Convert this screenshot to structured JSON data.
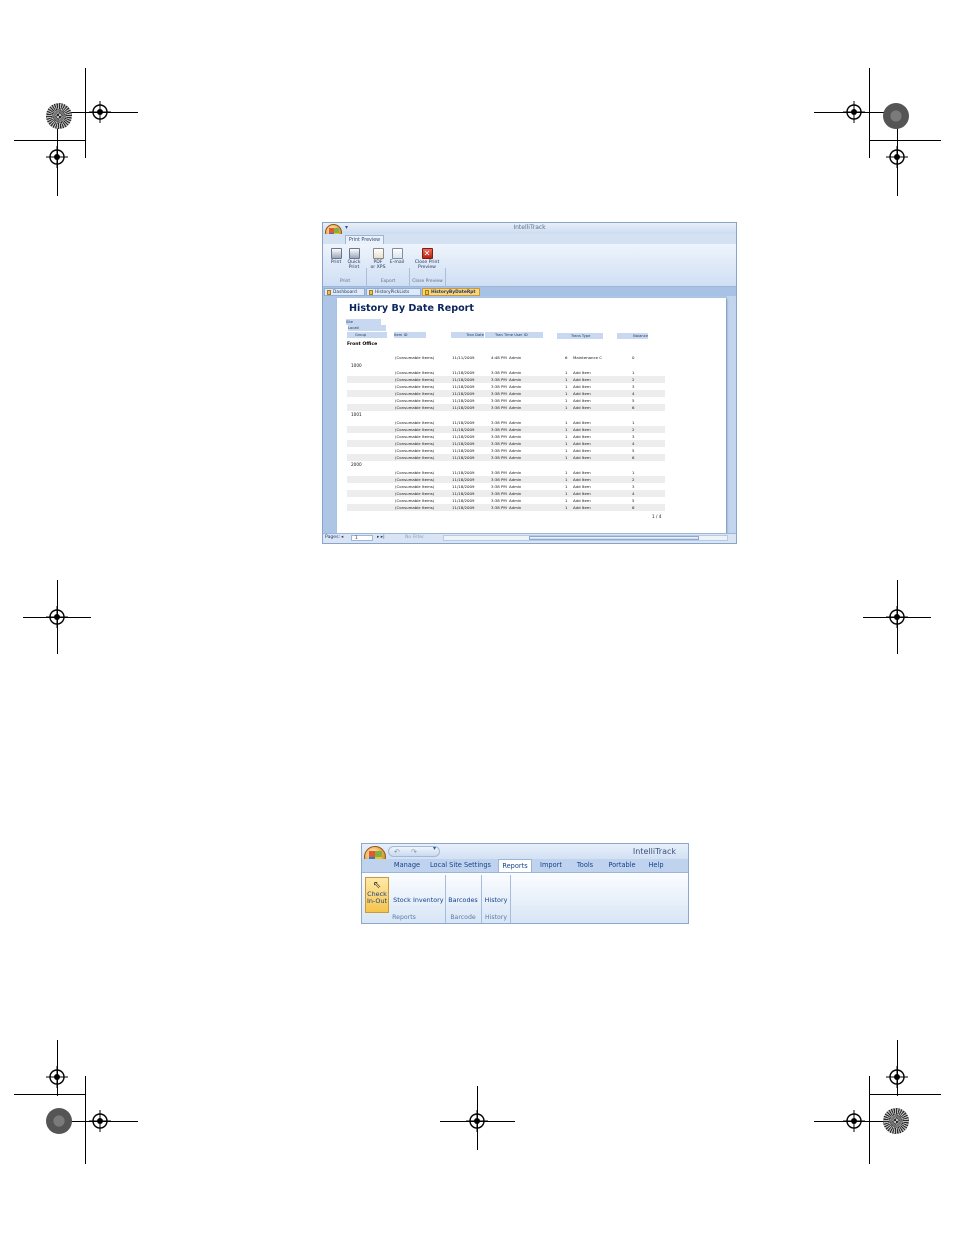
{
  "preview_window": {
    "app_title": "IntelliTrack",
    "qat_arrow": "▾",
    "ribbon_tab": "Print Preview",
    "buttons": {
      "print": "Print",
      "quick_print_1": "Quick",
      "quick_print_2": "Print",
      "pdf_1": "PDF",
      "pdf_2": "or XPS",
      "email": "E-mail",
      "close_1": "Close Print",
      "close_2": "Preview"
    },
    "groups": {
      "print": "Print",
      "export": "Export",
      "close": "Close Preview"
    },
    "document_tabs": [
      "Dashboard",
      "HistoryPickLists",
      "HistoryByDateRpt"
    ],
    "status": {
      "pages_label": "Pages:",
      "page_value": "1",
      "filter": "No Filter"
    },
    "report": {
      "title": "History By Date Report",
      "header_site": "Site",
      "header_location": "Locati",
      "header_group": "Group",
      "columns": [
        "Item ID",
        "Tran Date",
        "Tran Time  User ID",
        "Trans Type",
        "Balance"
      ],
      "site_name": "Front Office",
      "first_row": {
        "item": "(Consumable Items)",
        "date": "11/11/2009",
        "time": "4:48 PM",
        "user": "Admin",
        "qty": "6",
        "type": "Maintenance C",
        "bal": "0"
      },
      "groups": [
        {
          "name": "1000",
          "rows": [
            {
              "item": "(Consumable Items)",
              "date": "11/18/2009",
              "time": "3:38 PM",
              "user": "Admin",
              "qty": "1",
              "type": "Add Item",
              "bal": "1"
            },
            {
              "item": "(Consumable Items)",
              "date": "11/18/2009",
              "time": "3:38 PM",
              "user": "Admin",
              "qty": "1",
              "type": "Add Item",
              "bal": "2"
            },
            {
              "item": "(Consumable Items)",
              "date": "11/18/2009",
              "time": "3:38 PM",
              "user": "Admin",
              "qty": "1",
              "type": "Add Item",
              "bal": "3"
            },
            {
              "item": "(Consumable Items)",
              "date": "11/18/2009",
              "time": "3:38 PM",
              "user": "Admin",
              "qty": "1",
              "type": "Add Item",
              "bal": "4"
            },
            {
              "item": "(Consumable Items)",
              "date": "11/18/2009",
              "time": "3:38 PM",
              "user": "Admin",
              "qty": "1",
              "type": "Add Item",
              "bal": "5"
            },
            {
              "item": "(Consumable Items)",
              "date": "11/18/2009",
              "time": "3:38 PM",
              "user": "Admin",
              "qty": "1",
              "type": "Add Item",
              "bal": "6"
            }
          ]
        },
        {
          "name": "1001",
          "rows": [
            {
              "item": "(Consumable Items)",
              "date": "11/18/2009",
              "time": "3:38 PM",
              "user": "Admin",
              "qty": "1",
              "type": "Add Item",
              "bal": "1"
            },
            {
              "item": "(Consumable Items)",
              "date": "11/18/2009",
              "time": "3:38 PM",
              "user": "Admin",
              "qty": "1",
              "type": "Add Item",
              "bal": "2"
            },
            {
              "item": "(Consumable Items)",
              "date": "11/18/2009",
              "time": "3:38 PM",
              "user": "Admin",
              "qty": "1",
              "type": "Add Item",
              "bal": "3"
            },
            {
              "item": "(Consumable Items)",
              "date": "11/18/2009",
              "time": "3:38 PM",
              "user": "Admin",
              "qty": "1",
              "type": "Add Item",
              "bal": "4"
            },
            {
              "item": "(Consumable Items)",
              "date": "11/18/2009",
              "time": "3:38 PM",
              "user": "Admin",
              "qty": "1",
              "type": "Add Item",
              "bal": "5"
            },
            {
              "item": "(Consumable Items)",
              "date": "11/18/2009",
              "time": "3:38 PM",
              "user": "Admin",
              "qty": "1",
              "type": "Add Item",
              "bal": "6"
            }
          ]
        },
        {
          "name": "2000",
          "rows": [
            {
              "item": "(Consumable Items)",
              "date": "11/18/2009",
              "time": "3:38 PM",
              "user": "Admin",
              "qty": "1",
              "type": "Add Item",
              "bal": "1"
            },
            {
              "item": "(Consumable Items)",
              "date": "11/18/2009",
              "time": "3:38 PM",
              "user": "Admin",
              "qty": "1",
              "type": "Add Item",
              "bal": "2"
            },
            {
              "item": "(Consumable Items)",
              "date": "11/18/2009",
              "time": "3:38 PM",
              "user": "Admin",
              "qty": "1",
              "type": "Add Item",
              "bal": "3"
            },
            {
              "item": "(Consumable Items)",
              "date": "11/18/2009",
              "time": "3:38 PM",
              "user": "Admin",
              "qty": "1",
              "type": "Add Item",
              "bal": "4"
            },
            {
              "item": "(Consumable Items)",
              "date": "11/18/2009",
              "time": "3:38 PM",
              "user": "Admin",
              "qty": "1",
              "type": "Add Item",
              "bal": "5"
            },
            {
              "item": "(Consumable Items)",
              "date": "11/18/2009",
              "time": "3:38 PM",
              "user": "Admin",
              "qty": "1",
              "type": "Add Item",
              "bal": "6"
            }
          ]
        }
      ],
      "page_number": "1 / 4"
    }
  },
  "ribbon_window": {
    "app_title": "IntelliTrack",
    "qat_undo": "↶",
    "qat_redo": "↷",
    "qat_arrow": "▾",
    "tabs": [
      "Manage",
      "Local Site Settings",
      "Reports",
      "Import",
      "Tools",
      "Portable",
      "Help"
    ],
    "active_tab": "Reports",
    "buttons": {
      "check_1": "Check",
      "check_2": "In-Out",
      "stock": "Stock",
      "inventory": "Inventory",
      "barcodes": "Barcodes",
      "history": "History"
    },
    "groups": {
      "reports": "Reports",
      "barcode": "Barcode",
      "history": "History"
    }
  }
}
